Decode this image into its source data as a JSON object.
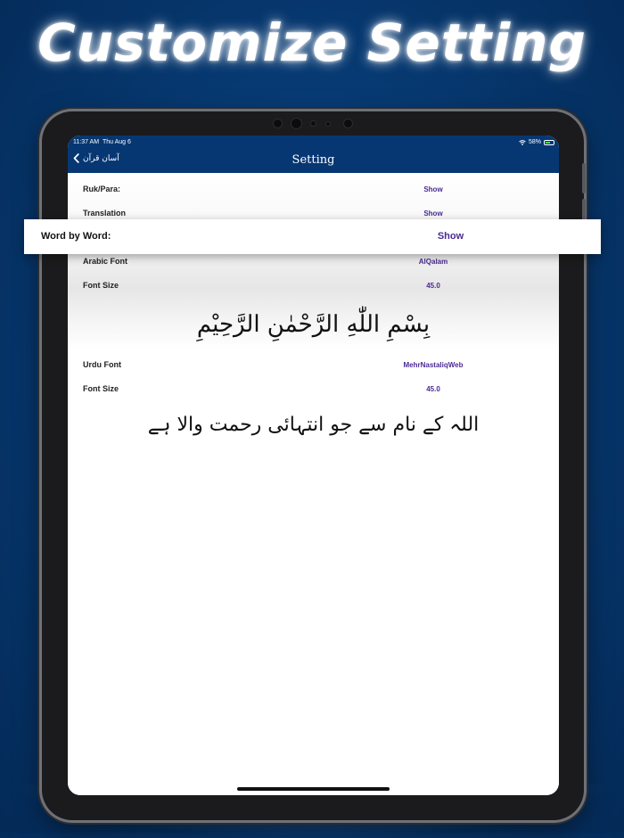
{
  "headline": "Customize Setting",
  "status_bar": {
    "time": "11:37 AM",
    "date": "Thu Aug 6",
    "battery": "58%"
  },
  "navbar": {
    "back_label": "آسان قرآن",
    "title": "Setting"
  },
  "settings": [
    {
      "label": "Ruk/Para:",
      "value": "Show"
    },
    {
      "label": "Translation",
      "value": "Show"
    },
    {
      "label": "Word by Word:",
      "value": "Show"
    },
    {
      "label": "Arabic Font",
      "value": "AlQalam"
    },
    {
      "label": "Font Size",
      "value": "45.0"
    },
    {
      "label": "Urdu Font",
      "value": "MehrNastaliqWeb"
    },
    {
      "label": "Font Size",
      "value": "45.0"
    }
  ],
  "previews": {
    "arabic": "بِسْمِ اللّٰهِ الرَّحْمٰنِ الرَّحِيْمِ",
    "urdu": "اللہ کے نام سے جو انتہائی رحمت والا ہے"
  },
  "colors": {
    "background": "#073a73",
    "navbar": "#063773",
    "value_text": "#4a2b93"
  }
}
